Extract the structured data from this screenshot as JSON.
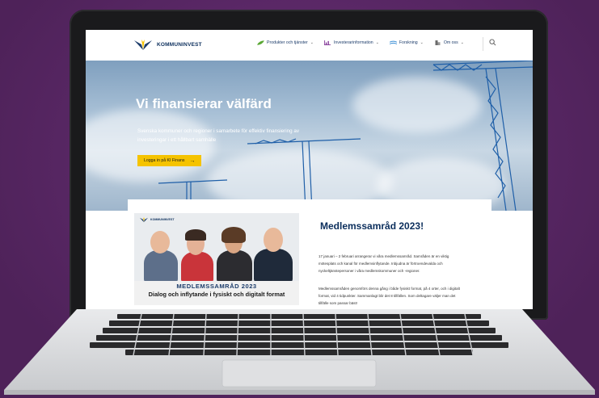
{
  "nav": {
    "logo_text": "KOMMUNINVEST",
    "items": [
      {
        "label": "Produkter och tjänster",
        "icon": "leaf-icon",
        "color": "#5aa835"
      },
      {
        "label": "Investerarinformation",
        "icon": "chart-icon",
        "color": "#7b2c91"
      },
      {
        "label": "Forskning",
        "icon": "wave-icon",
        "color": "#3b8fd6"
      },
      {
        "label": "Om oss",
        "icon": "building-icon",
        "color": "#6b6b6b"
      }
    ],
    "chevron": "⌄"
  },
  "hero": {
    "title": "Vi finansierar välfärd",
    "subtitle": "Svenska kommuner och regioner i samarbete för effektiv finansiering av investeringar i ett hållbart samhälle",
    "button_label": "Logga in på KI Finans",
    "button_arrow": "→"
  },
  "promo": {
    "logo_text": "KOMMUNINVEST",
    "title": "MEDLEMSSAMRÅD 2023",
    "subtitle": "Dialog och inflytande i fysiskt och digitalt format"
  },
  "news": {
    "title": "Medlemssamråd 2023!",
    "paragraphs": [
      "17 januari – 2 februari arrangerar vi våra medlemssamråd. Samråden är en viktig mötesplats och kanal för medlemsinflytande. Inbjudna är förtroendevalda och nyckeltjänstepersoner i våra medlemskommuner och -regioner.",
      "Medlemssamråden genomförs denna gång i både fysiskt format, på 4 orter, och i digitalt format, vid 4 tidpunkter. Sammanlagt blir det 8 tillfällen. Som deltagare väljer man det tillfälle som passar bäst!"
    ]
  },
  "colors": {
    "background": "#5a2a66",
    "accent": "#f5c300",
    "brand": "#0b2e5c"
  }
}
